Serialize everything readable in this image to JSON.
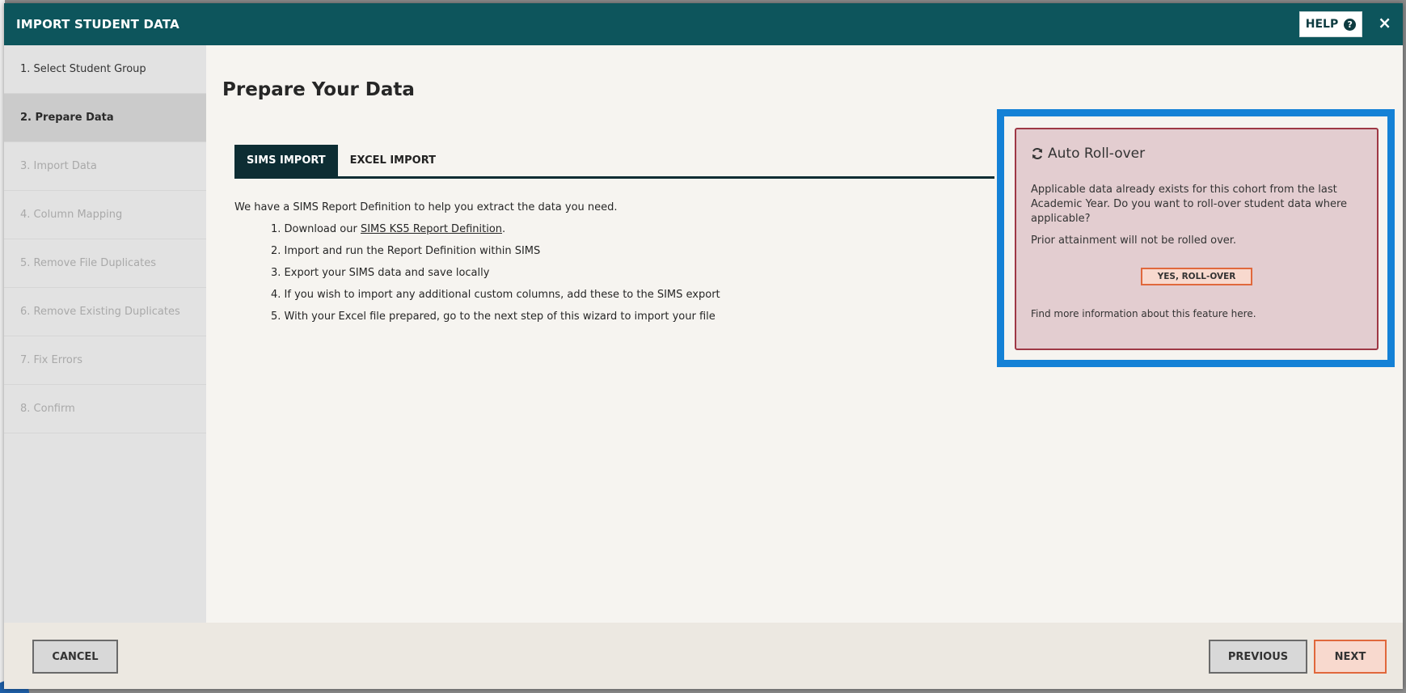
{
  "header": {
    "title": "IMPORT STUDENT DATA",
    "help_label": "HELP",
    "help_icon": "question-circle-icon",
    "close_glyph": "×"
  },
  "sidebar": {
    "steps": [
      {
        "label": "1. Select Student Group",
        "state": "done"
      },
      {
        "label": "2. Prepare Data",
        "state": "active"
      },
      {
        "label": "3. Import Data",
        "state": "pending"
      },
      {
        "label": "4. Column Mapping",
        "state": "pending"
      },
      {
        "label": "5. Remove File Duplicates",
        "state": "pending"
      },
      {
        "label": "6. Remove Existing Duplicates",
        "state": "pending"
      },
      {
        "label": "7. Fix Errors",
        "state": "pending"
      },
      {
        "label": "8. Confirm",
        "state": "pending"
      }
    ]
  },
  "main": {
    "title": "Prepare Your Data",
    "tabs": [
      {
        "label": "SIMS IMPORT",
        "active": true
      },
      {
        "label": "EXCEL IMPORT",
        "active": false
      }
    ],
    "intro": "We have a SIMS Report Definition to help you extract the data you need.",
    "steps": {
      "s1_prefix": "1. Download our ",
      "s1_link": "SIMS KS5 Report Definition",
      "s1_suffix": ".",
      "s2": "2. Import and run the Report Definition within SIMS",
      "s3": "3. Export your SIMS data and save locally",
      "s4": "4. If you wish to import any additional custom columns, add these to the SIMS export",
      "s5": "5. With your Excel file prepared, go to the next step of this wizard to import your file"
    }
  },
  "rollover": {
    "icon": "refresh-icon",
    "title": "Auto Roll-over",
    "text1": "Applicable data already exists for this cohort from the last Academic Year. Do you want to roll-over student data where applicable?",
    "text2": "Prior attainment will not be rolled over.",
    "button_label": "YES, ROLL-OVER",
    "footnote": "Find more information about this feature here."
  },
  "footer": {
    "cancel_label": "CANCEL",
    "previous_label": "PREVIOUS",
    "next_label": "NEXT"
  },
  "colors": {
    "header_bg": "#0d555c",
    "tab_active": "#0d2d33",
    "focus_border": "#1481d6",
    "card_bg": "#e3cdd0",
    "card_border": "#9e3845",
    "accent_orange": "#e0683c"
  }
}
